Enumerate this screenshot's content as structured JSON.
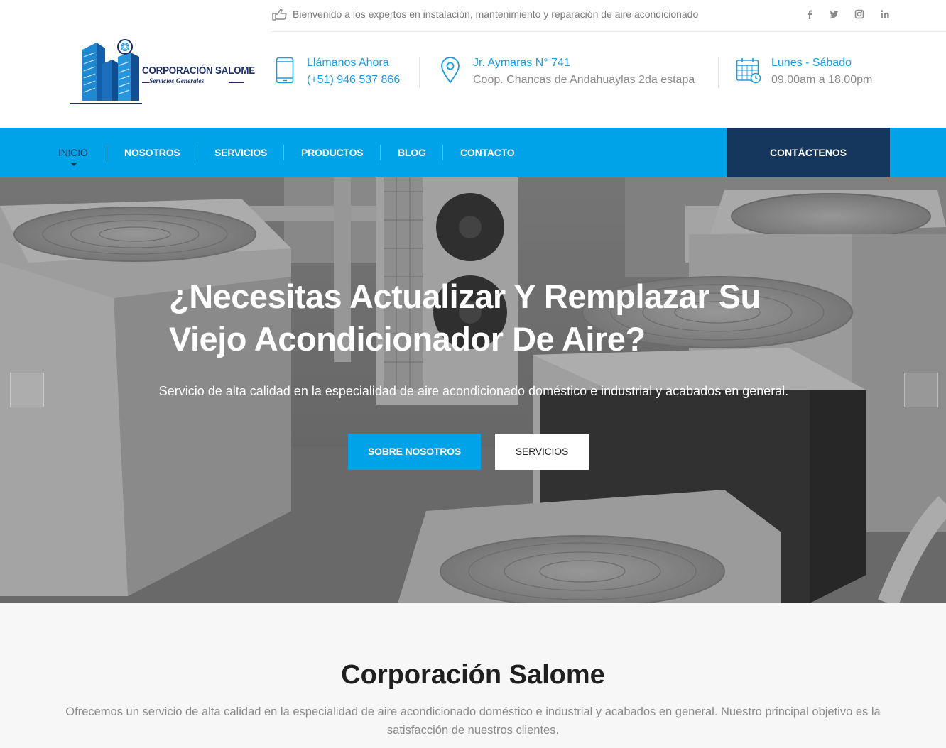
{
  "header": {
    "logo": {
      "name": "CORPORACIÓN SALOME",
      "tagline": "Servicios Generales"
    },
    "welcome": "Bienvenido a los expertos en instalación, mantenimiento y reparación de aire acondicionado",
    "social": [
      {
        "icon": "facebook-icon",
        "glyph": "f"
      },
      {
        "icon": "twitter-icon",
        "glyph": "t"
      },
      {
        "icon": "instagram-icon",
        "glyph": ""
      },
      {
        "icon": "linkedin-icon",
        "glyph": "in"
      }
    ],
    "info": [
      {
        "icon": "phone-icon",
        "title": "Llámanos Ahora",
        "sub": "(+51) 946 537 866"
      },
      {
        "icon": "location-pin-icon",
        "title": "Jr. Aymaras N° 741",
        "sub": "Coop. Chancas de Andahuaylas 2da estapa"
      },
      {
        "icon": "calendar-icon",
        "title": "Lunes - Sábado",
        "sub": "09.00am a 18.00pm"
      }
    ]
  },
  "nav": {
    "items": [
      "INICIO",
      "NOSOTROS",
      "SERVICIOS",
      "PRODUCTOS",
      "BLOG",
      "CONTACTO"
    ],
    "cta": "CONTÁCTENOS"
  },
  "hero": {
    "title": "¿Necesitas Actualizar Y Remplazar Su Viejo Acondicionador De Aire?",
    "subtitle": "Servicio de alta calidad en la especialidad de aire acondicionado doméstico e industrial y acabados en general.",
    "primary_button": "SOBRE NOSOTROS",
    "secondary_button": "SERVICIOS"
  },
  "about": {
    "title": "Corporación Salome",
    "text": "Ofrecemos un servicio de alta calidad en la especialidad de aire acondicionado doméstico e industrial y acabados en general. Nuestro principal objetivo es la satisfacción de nuestros clientes."
  },
  "colors": {
    "primary": "#00a2e8",
    "dark": "#15375e",
    "info_title": "#1a9be0"
  }
}
